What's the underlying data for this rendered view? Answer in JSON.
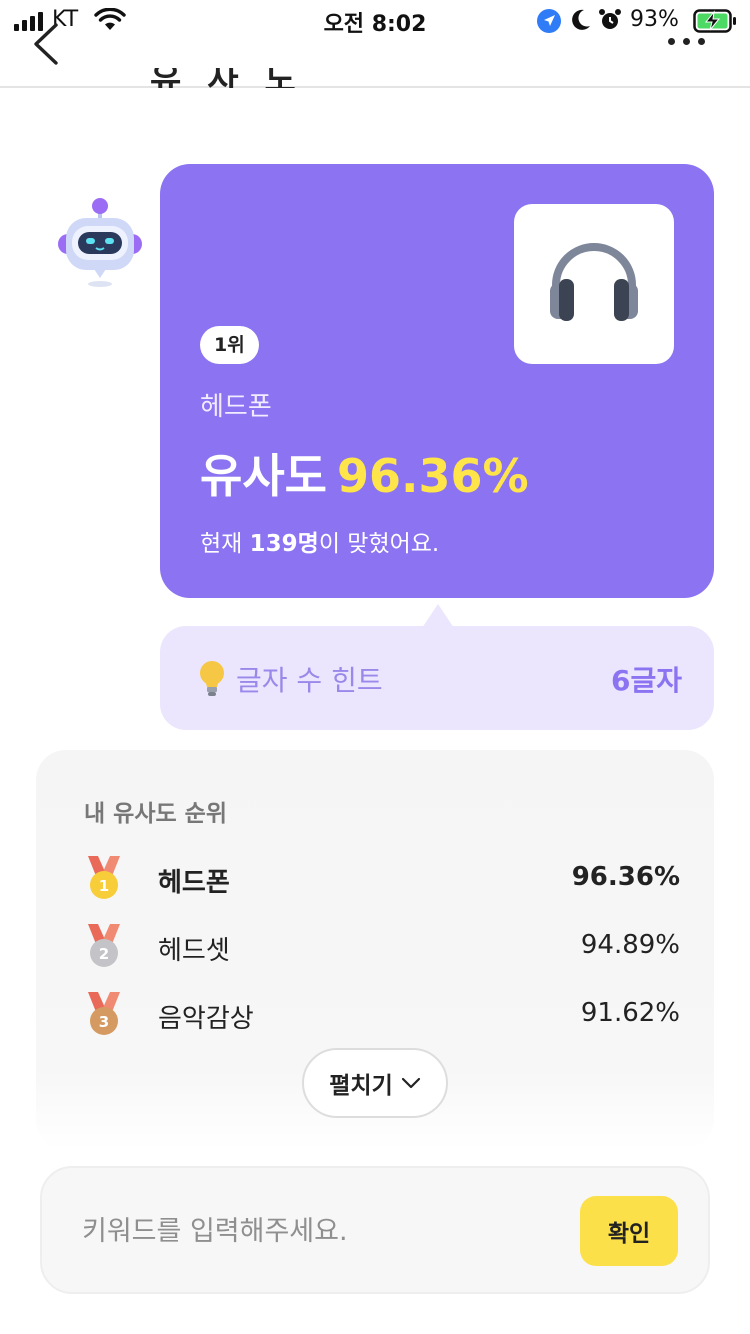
{
  "status_bar": {
    "carrier": "KT",
    "time": "오전 8:02",
    "battery": "93%"
  },
  "nav": {
    "title_partial": "유사도"
  },
  "result_card": {
    "rank_badge": "1위",
    "word": "헤드폰",
    "similarity_label": "유사도",
    "similarity_value": "96.36%",
    "solvers_prefix": "현재 ",
    "solvers_count": "139명",
    "solvers_suffix": "이 맞혔어요.",
    "image_icon": "headphones-icon"
  },
  "hint": {
    "label": "글자 수 힌트",
    "value": "6글자",
    "icon": "lightbulb-icon"
  },
  "ranking": {
    "title": "내 유사도 순위",
    "items": [
      {
        "rank": "1",
        "word": "헤드폰",
        "score": "96.36%",
        "medal": "gold-medal-icon"
      },
      {
        "rank": "2",
        "word": "헤드셋",
        "score": "94.89%",
        "medal": "silver-medal-icon"
      },
      {
        "rank": "3",
        "word": "음악감상",
        "score": "91.62%",
        "medal": "bronze-medal-icon"
      }
    ],
    "expand_label": "펼치기"
  },
  "keyword_input": {
    "placeholder": "키워드를 입력해주세요.",
    "value": "",
    "submit_label": "확인"
  },
  "colors": {
    "card_purple": "#8b73f1",
    "highlight_yellow": "#ffe44a",
    "hint_bg": "#ebe6fd",
    "confirm_yellow": "#fbe04a"
  }
}
